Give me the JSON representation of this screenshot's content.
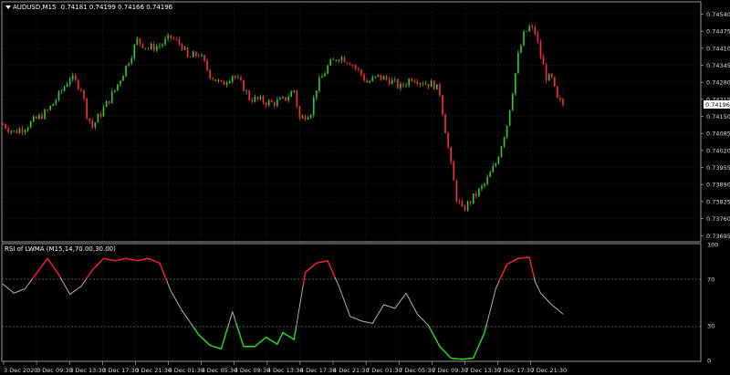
{
  "main_window": {
    "symbol_timeframe": "AUDUSD,M15",
    "ohlc": "0.74181 0.74199 0.74166 0.74196",
    "current_price": "0.74196",
    "price_ticks": [
      "0.74540",
      "0.74475",
      "0.74410",
      "0.74345",
      "0.74280",
      "0.74215",
      "0.74150",
      "0.74085",
      "0.74020",
      "0.73955",
      "0.73890",
      "0.73825",
      "0.73760",
      "0.73695"
    ]
  },
  "indicator_window": {
    "name": "RSI of LWMA (M15,14,70.00,30.00)",
    "scale_ticks": [
      "100",
      "70",
      "30",
      "0"
    ]
  },
  "time_axis": {
    "labels": [
      "3 Dec 2020",
      "3 Dec 09:30",
      "3 Dec 13:30",
      "3 Dec 17:30",
      "3 Dec 21:30",
      "4 Dec 01:30",
      "4 Dec 05:30",
      "4 Dec 09:30",
      "4 Dec 13:30",
      "4 Dec 17:30",
      "4 Dec 21:30",
      "7 Dec 01:30",
      "7 Dec 05:30",
      "7 Dec 09:30",
      "7 Dec 13:30",
      "7 Dec 17:30",
      "7 Dec 21:30"
    ]
  },
  "colors": {
    "bull": "#32cd32",
    "bear": "#ff3030",
    "rsi_overbought": "#ff2020",
    "rsi_oversold": "#20e020",
    "rsi_normal": "#c0c0c0",
    "grid": "#1f1f1f",
    "axis": "#c0c0c0"
  },
  "chart_data": [
    {
      "type": "candlestick",
      "title": "AUDUSD,M15",
      "ylim": [
        0.73675,
        0.7458
      ],
      "x_labels": [
        "3 Dec 2020",
        "3 Dec 09:30",
        "3 Dec 13:30",
        "3 Dec 17:30",
        "3 Dec 21:30",
        "4 Dec 01:30",
        "4 Dec 05:30",
        "4 Dec 09:30",
        "4 Dec 13:30",
        "4 Dec 17:30",
        "4 Dec 21:30",
        "7 Dec 01:30",
        "7 Dec 05:30",
        "7 Dec 09:30",
        "7 Dec 13:30",
        "7 Dec 17:30",
        "7 Dec 21:30"
      ],
      "close_path": [
        [
          0,
          0.7412
        ],
        [
          4,
          0.7409
        ],
        [
          8,
          0.7411
        ],
        [
          12,
          0.7414
        ],
        [
          16,
          0.7417
        ],
        [
          20,
          0.7423
        ],
        [
          24,
          0.743
        ],
        [
          28,
          0.7426
        ],
        [
          30,
          0.7416
        ],
        [
          32,
          0.7411
        ],
        [
          36,
          0.7418
        ],
        [
          40,
          0.7425
        ],
        [
          44,
          0.7434
        ],
        [
          48,
          0.7444
        ],
        [
          52,
          0.7441
        ],
        [
          56,
          0.7442
        ],
        [
          60,
          0.7445
        ],
        [
          64,
          0.7442
        ],
        [
          66,
          0.7437
        ],
        [
          70,
          0.7439
        ],
        [
          74,
          0.7431
        ],
        [
          78,
          0.7427
        ],
        [
          82,
          0.7431
        ],
        [
          86,
          0.7426
        ],
        [
          88,
          0.7422
        ],
        [
          92,
          0.7421
        ],
        [
          96,
          0.742
        ],
        [
          100,
          0.7421
        ],
        [
          104,
          0.7425
        ],
        [
          106,
          0.7414
        ],
        [
          110,
          0.7417
        ],
        [
          112,
          0.7426
        ],
        [
          116,
          0.7434
        ],
        [
          120,
          0.7438
        ],
        [
          124,
          0.7436
        ],
        [
          128,
          0.7431
        ],
        [
          130,
          0.7428
        ],
        [
          134,
          0.743
        ],
        [
          138,
          0.7429
        ],
        [
          142,
          0.7426
        ],
        [
          146,
          0.743
        ],
        [
          150,
          0.7428
        ],
        [
          154,
          0.7427
        ],
        [
          156,
          0.7424
        ],
        [
          158,
          0.741
        ],
        [
          160,
          0.7396
        ],
        [
          162,
          0.7384
        ],
        [
          164,
          0.7379
        ],
        [
          168,
          0.7384
        ],
        [
          172,
          0.7389
        ],
        [
          176,
          0.7397
        ],
        [
          180,
          0.7412
        ],
        [
          182,
          0.7425
        ],
        [
          184,
          0.7438
        ],
        [
          186,
          0.7446
        ],
        [
          188,
          0.7449
        ],
        [
          190,
          0.7447
        ],
        [
          192,
          0.7438
        ],
        [
          194,
          0.743
        ],
        [
          196,
          0.7429
        ],
        [
          198,
          0.7421
        ],
        [
          200,
          0.74196
        ]
      ]
    },
    {
      "type": "line",
      "title": "RSI of LWMA (M15,14,70.00,30.00)",
      "ylim": [
        0,
        100
      ],
      "levels": [
        70,
        30
      ],
      "x": [
        0,
        4,
        8,
        12,
        16,
        20,
        24,
        28,
        32,
        36,
        40,
        44,
        48,
        52,
        56,
        60,
        64,
        66,
        70,
        74,
        78,
        82,
        86,
        90,
        94,
        98,
        100,
        104,
        108,
        112,
        116,
        120,
        124,
        128,
        132,
        136,
        140,
        144,
        148,
        152,
        156,
        160,
        164,
        168,
        172,
        176,
        180,
        184,
        188,
        190,
        192,
        196,
        200
      ],
      "values": [
        66,
        58,
        62,
        75,
        88,
        74,
        57,
        64,
        78,
        88,
        86,
        88,
        86,
        88,
        84,
        60,
        43,
        36,
        22,
        13,
        10,
        42,
        12,
        12,
        20,
        14,
        24,
        18,
        76,
        84,
        86,
        64,
        38,
        34,
        32,
        48,
        45,
        58,
        40,
        30,
        12,
        2,
        1,
        2,
        24,
        62,
        83,
        88,
        89,
        68,
        58,
        48,
        40
      ]
    }
  ]
}
